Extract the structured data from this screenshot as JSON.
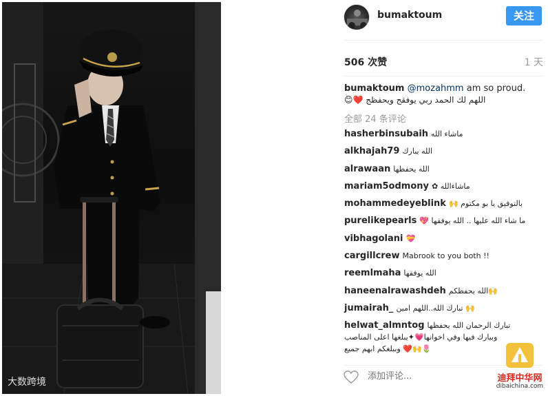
{
  "photo": {
    "watermark": "大数跨境"
  },
  "header": {
    "username": "bumaktoum",
    "follow_label": "关注"
  },
  "stats": {
    "likes": "506 次赞",
    "time_ago": "1 天"
  },
  "caption": {
    "username": "bumaktoum",
    "mention": "@mozahmm",
    "text": " am so proud.",
    "text_rtl": "اللهم لك الحمد ربي يوفقج ويحفظج ❤️😊"
  },
  "view_all_comments": "全部 24 条评论",
  "comments": [
    {
      "user": "hasherbinsubaih",
      "text": "ماشاء الله"
    },
    {
      "user": "alkhajah79",
      "text": "الله يبارك"
    },
    {
      "user": "alrawaan",
      "text": "الله يحفظها"
    },
    {
      "user": "mariam5odmony",
      "text": "✿ ماشاءالله"
    },
    {
      "user": "mohammedeyeblink",
      "text": "🙌 بالتوفيق يا بو مكتوم"
    },
    {
      "user": "purelikepearls",
      "text": "💖 ما شاء الله عليها .. الله يوفقها"
    },
    {
      "user": "vibhagolani",
      "text": "💝"
    },
    {
      "user": "cargillcrew",
      "text": "Mabrook to you both !!"
    },
    {
      "user": "reemlmaha",
      "text": "الله يوفقها"
    },
    {
      "user": "haneenalrawashdeh",
      "text": "الله يحفظكم🙌"
    },
    {
      "user": "jumairah_",
      "text": "تبارك الله..اللهم امين 🙌"
    },
    {
      "user": "helwat_almntog",
      "text": "تبارك الرحمان الله يحفظها",
      "lines": [
        "وبيارك فيها وفي اخوانها💗✦يبلغها اعلى المناصب",
        "وببلغكم ابهم جميع ❤️🙌🌷"
      ]
    }
  ],
  "add_comment": {
    "placeholder": "添加评论..."
  },
  "brand": {
    "name": "迪拜中华网",
    "url": "dibaichina.com"
  }
}
